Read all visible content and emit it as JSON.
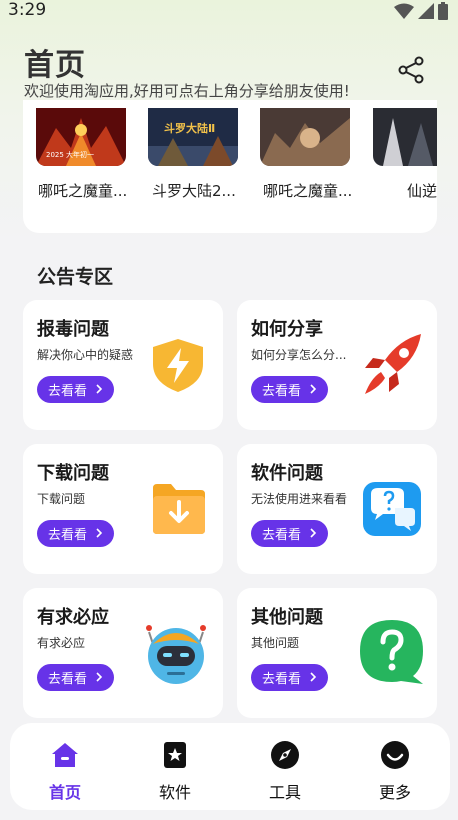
{
  "status_bar": {
    "time": "3:29"
  },
  "header": {
    "title": "首页",
    "subtitle": "欢迎使用淘应用,好用可点右上角分享给朋友使用!"
  },
  "carousel": {
    "items": [
      {
        "title": "哪吒之魔童...",
        "poster_text": "2025 大年初一"
      },
      {
        "title": "斗罗大陆2...",
        "poster_text": "斗罗大陆Ⅱ"
      },
      {
        "title": "哪吒之魔童..."
      },
      {
        "title": "仙逆"
      }
    ]
  },
  "notices": {
    "section_title": "公告专区",
    "cards": [
      {
        "title": "报毒问题",
        "desc": "解决你心中的疑惑",
        "button": "去看看",
        "icon": "shield-bolt-icon"
      },
      {
        "title": "如何分享",
        "desc": "如何分享怎么分...",
        "button": "去看看",
        "icon": "rocket-icon"
      },
      {
        "title": "下载问题",
        "desc": "下载问题",
        "button": "去看看",
        "icon": "download-folder-icon"
      },
      {
        "title": "软件问题",
        "desc": "无法使用进来看看",
        "button": "去看看",
        "icon": "question-chat-icon"
      },
      {
        "title": "有求必应",
        "desc": "有求必应",
        "button": "去看看",
        "icon": "robot-icon"
      },
      {
        "title": "其他问题",
        "desc": "其他问题",
        "button": "去看看",
        "icon": "question-bubble-icon"
      }
    ]
  },
  "bottom_nav": {
    "items": [
      {
        "label": "首页",
        "icon": "home-icon",
        "active": true
      },
      {
        "label": "软件",
        "icon": "star-bookmark-icon"
      },
      {
        "label": "工具",
        "icon": "compass-icon"
      },
      {
        "label": "更多",
        "icon": "smile-icon"
      }
    ]
  },
  "colors": {
    "accent": "#6733e8",
    "card_bg": "#ffffff",
    "page_bg": "#f3f3f5"
  }
}
